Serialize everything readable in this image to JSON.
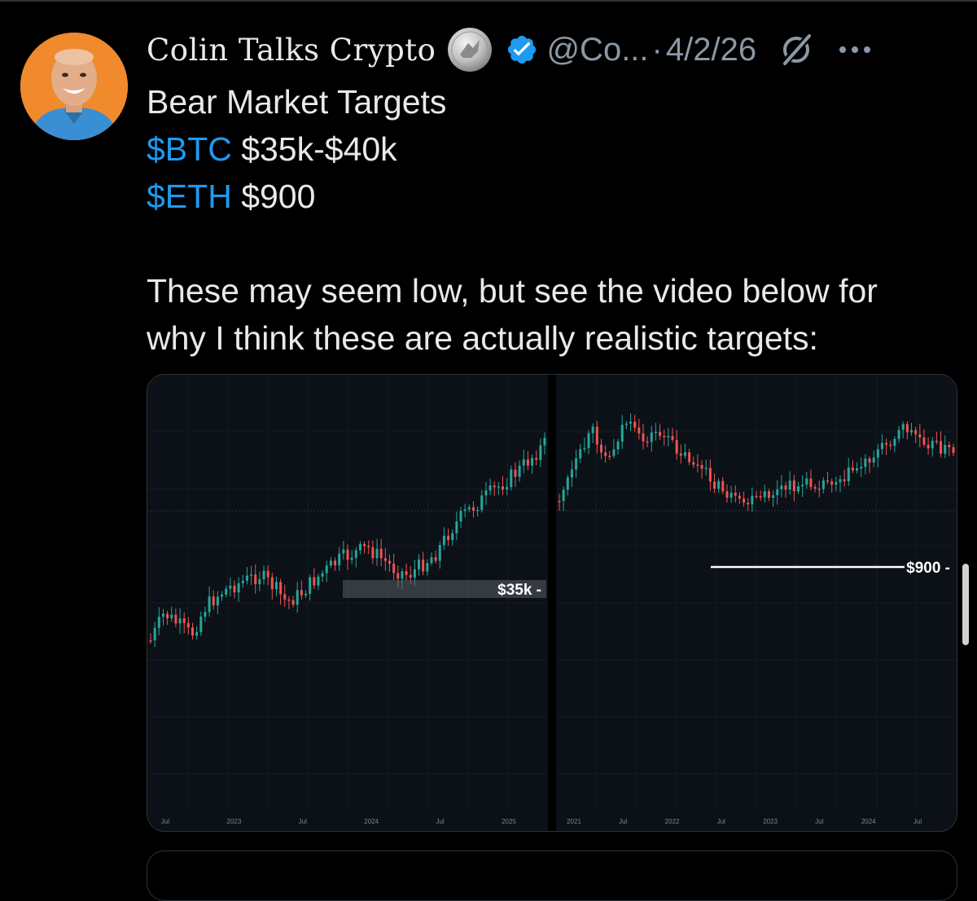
{
  "tweet": {
    "author": {
      "display_name": "Colin Talks Crypto",
      "handle": "@Co...",
      "separator": "·",
      "date": "4/2/26"
    },
    "lines": [
      {
        "parts": [
          {
            "text": "Bear Market Targets",
            "cashtag": false
          }
        ]
      },
      {
        "parts": [
          {
            "text": "$BTC",
            "cashtag": true
          },
          {
            "text": " $35k-$40k",
            "cashtag": false
          }
        ]
      },
      {
        "parts": [
          {
            "text": "$ETH",
            "cashtag": true
          },
          {
            "text": " $900",
            "cashtag": false
          }
        ]
      },
      {
        "parts": []
      },
      {
        "parts": [
          {
            "text": "These may seem low, but see the video below for",
            "cashtag": false
          }
        ]
      },
      {
        "parts": [
          {
            "text": "why I think these are actually realistic targets:",
            "cashtag": false
          }
        ]
      }
    ],
    "icons": {
      "coin_badge": "silver-eagle-coin-icon",
      "verified": "verified-badge-icon",
      "grok": "grok-icon",
      "more": "more-options-icon"
    }
  },
  "colors": {
    "cashtag": "#1d9bf0",
    "muted_text": "#8b98a5",
    "verified_badge": "#1d9bf0",
    "chart_bg": "#0c1118",
    "candle_up": "#26a69a",
    "candle_down": "#ef5350",
    "target_zone": "#5a5f66"
  },
  "chart_data": [
    {
      "type": "candlestick",
      "x_ticks": [
        "Jul",
        "2023",
        "Jul",
        "2024",
        "Jul",
        "2025"
      ],
      "price_label": "$35k",
      "annotation": "shaded target zone near $35k",
      "shape": [
        0.72,
        0.62,
        0.66,
        0.7,
        0.6,
        0.55,
        0.52,
        0.5,
        0.48,
        0.52,
        0.58,
        0.55,
        0.5,
        0.46,
        0.42,
        0.4,
        0.38,
        0.42,
        0.46,
        0.48,
        0.44,
        0.4,
        0.32,
        0.26,
        0.22,
        0.18,
        0.14,
        0.1,
        0.05,
        0.0
      ]
    },
    {
      "type": "candlestick",
      "x_ticks": [
        "2021",
        "Jul",
        "2022",
        "Jul",
        "2023",
        "Jul",
        "2024",
        "Jul"
      ],
      "price_label": "$900",
      "annotation": "horizontal line at $900",
      "shape": [
        0.35,
        0.2,
        0.05,
        0.18,
        0.0,
        0.1,
        0.05,
        0.12,
        0.18,
        0.25,
        0.32,
        0.38,
        0.36,
        0.33,
        0.3,
        0.29,
        0.28,
        0.26,
        0.22,
        0.16,
        0.1,
        0.03,
        0.08,
        0.12,
        0.14
      ]
    }
  ]
}
